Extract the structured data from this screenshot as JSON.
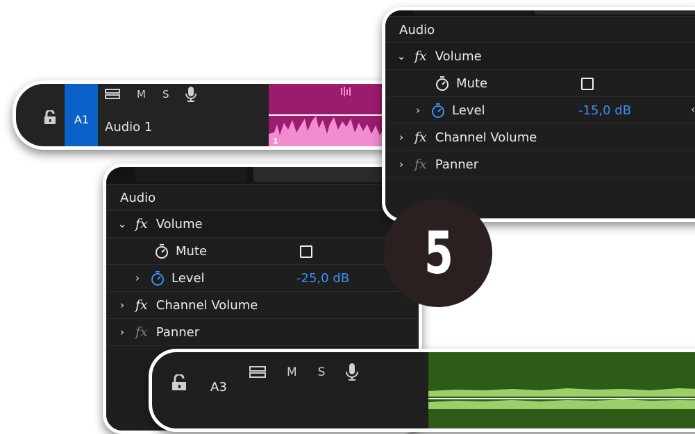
{
  "track_a1": {
    "lock_icon": "lock-open-icon",
    "label": "A1",
    "name": "Audio 1",
    "toggle_m": "M",
    "toggle_s": "S",
    "clip_number": "1",
    "accent": "#0a62c8",
    "clip_color": "#9b1b6e"
  },
  "panel_top": {
    "section": "Audio",
    "volume": "Volume",
    "mute": "Mute",
    "level": "Level",
    "level_value": "-15,0 dB",
    "channel_volume": "Channel Volume",
    "panner": "Panner"
  },
  "panel_bottom": {
    "section": "Audio",
    "volume": "Volume",
    "mute": "Mute",
    "level": "Level",
    "level_value": "-25,0 dB",
    "channel_volume": "Channel Volume",
    "panner": "Panner"
  },
  "badge": {
    "text": "5"
  },
  "track_a3": {
    "lock_icon": "lock-open-icon",
    "label": "A3",
    "toggle_m": "M",
    "toggle_s": "S",
    "clip_color": "#2e5b17"
  },
  "fx_symbol": "fx",
  "value_color": "#3b8ff0"
}
